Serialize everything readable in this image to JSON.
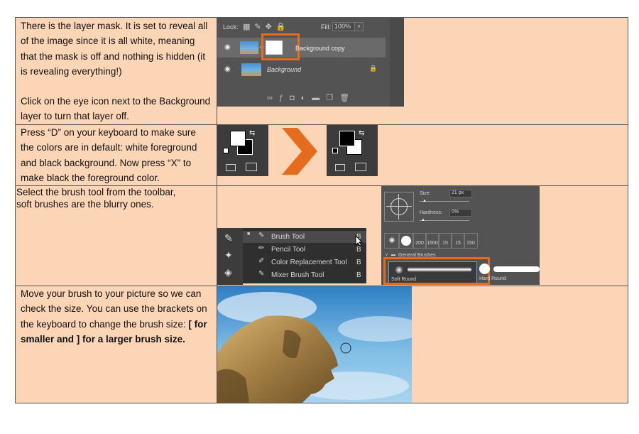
{
  "rows": [
    {
      "text1": "There is the layer mask. It is set to reveal all of the image since it is all white, meaning that the mask is off and nothing is hidden (it is revealing everything!)",
      "text2": "Click on the eye icon next to the Background layer to turn that layer off.",
      "panel": {
        "lock_label": "Lock:",
        "fill_label": "Fill:",
        "fill_value": "100%",
        "layers": [
          "Background copy",
          "Background"
        ]
      }
    },
    {
      "text": "Press “D” on your keyboard to make sure the colors are in default: white foreground and black background. Now press “X” to make black the foreground color."
    },
    {
      "text_line1": "Select the brush tool from the toolbar,",
      "text_line2": "soft brushes are the blurry ones.",
      "tool_menu": {
        "items": [
          {
            "label": "Brush Tool",
            "key": "B"
          },
          {
            "label": "Pencil Tool",
            "key": "B"
          },
          {
            "label": "Color Replacement Tool",
            "key": "B"
          },
          {
            "label": "Mixer Brush Tool",
            "key": "B"
          }
        ]
      },
      "brush_panel": {
        "size_label": "Size:",
        "size_value": "21 px",
        "hardness_label": "Hardness:",
        "hardness_value": "0%",
        "presets": [
          "200",
          "1600",
          "15",
          "15",
          "150"
        ],
        "group_label": "General Brushes",
        "soft_label": "Soft Round",
        "hard_label": "Hard Round"
      }
    },
    {
      "text_plain": "Move your brush to your picture so we can check the size. You can use the brackets on the keyboard to change the brush size: ",
      "text_bold": "[ for smaller and ] for a larger brush size."
    }
  ],
  "colors": {
    "cell_bg": "#fbd5b5",
    "accent": "#e56b1f",
    "ps_dark": "#535353"
  }
}
